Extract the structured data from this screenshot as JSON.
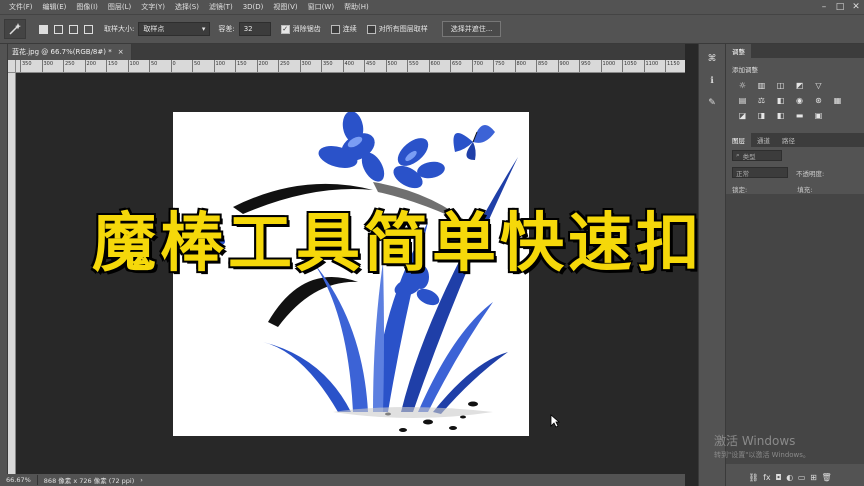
{
  "menu": [
    "文件(F)",
    "编辑(E)",
    "图像(I)",
    "图层(L)",
    "文字(Y)",
    "选择(S)",
    "滤镜(T)",
    "3D(D)",
    "视图(V)",
    "窗口(W)",
    "帮助(H)"
  ],
  "options": {
    "sample_size_label": "取样大小:",
    "sample_size_value": "取样点",
    "tolerance_label": "容差:",
    "tolerance_value": "32",
    "antialias_label": "消除锯齿",
    "contiguous_label": "连续",
    "sample_all_label": "对所有图层取样",
    "select_subject_button": "选择并遮住..."
  },
  "document": {
    "tab_title": "蓝花.jpg @ 66.7%(RGB/8#) *",
    "ruler_labels": [
      "350",
      "300",
      "250",
      "200",
      "150",
      "100",
      "50",
      "0",
      "50",
      "100",
      "150",
      "200",
      "250",
      "300",
      "350",
      "400",
      "450",
      "500",
      "550",
      "600",
      "650",
      "700",
      "750",
      "800",
      "850",
      "900",
      "950",
      "1000",
      "1050",
      "1100",
      "1150"
    ]
  },
  "headline": "魔棒工具简单快速扣图",
  "status": {
    "zoom": "66.67%",
    "doc_info": "868 像素 x 726 像素 (72 ppi)"
  },
  "right_panel": {
    "adjust_tab": "调整",
    "adjust_title": "添加调整",
    "layer_tabs": [
      "图层",
      "通道",
      "路径"
    ],
    "kind_label": "类型",
    "blend_mode": "正常",
    "opacity_label": "不透明度:",
    "lock_label": "锁定:",
    "fill_label": "填充:"
  },
  "watermark": {
    "line1": "激活 Windows",
    "line2": "转到\"设置\"以激活 Windows。"
  },
  "colors": {
    "headline": "#f5d80a",
    "panel_bg": "#535353",
    "canvas_bg": "#282828",
    "flower_blue": "#2a52c9"
  }
}
